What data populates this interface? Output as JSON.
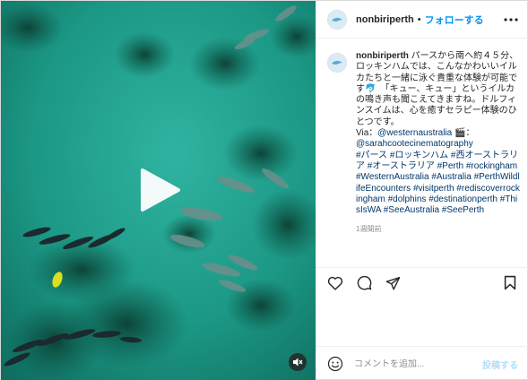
{
  "header": {
    "username": "nonbiriperth",
    "separator": "•",
    "follow_label": "フォローする"
  },
  "caption": {
    "username": "nonbiriperth",
    "text": " パースから南へ約４５分、ロッキンハムでは、こんなかわいいイルカたちと一緒に泳ぐ貴重な体験が可能です🐬　「キュー、キュー」というイルカの鳴き声も聞こえてきますね。ドルフィンスイムは、心を癒すセラピー体験のひとつです。",
    "via_prefix": "Via：",
    "via_mention_1": "@westernaustralia",
    "via_emoji": "🎬",
    "via_sep": "：",
    "via_mention_2": "@sarahcootecinematography",
    "hashtags": [
      "#パース",
      "#ロッキンハム",
      "#西オーストラリア",
      "#オーストラリア",
      "#Perth",
      "#rockingham",
      "#WesternAustralia",
      "#Australia",
      "#PerthWildlifeEncounters",
      "#visitperth",
      "#rediscoverrockingham",
      "#dolphins",
      "#destinationperth",
      "#ThisIsWA",
      "#SeeAustralia",
      "#SeePerth"
    ],
    "time_ago": "1週間前"
  },
  "comment": {
    "placeholder": "コメントを追加...",
    "post_label": "投稿する"
  },
  "icons": {
    "play": "play-icon",
    "sound": "speaker-muted-icon",
    "more": "more-options-icon",
    "like": "heart-icon",
    "comment": "comment-bubble-icon",
    "share": "paper-plane-icon",
    "save": "bookmark-icon",
    "emoji": "smiley-icon"
  },
  "colors": {
    "accent": "#0095f6",
    "link": "#00376b",
    "water": "#1fa08f",
    "muted": "#8e8e8e"
  }
}
